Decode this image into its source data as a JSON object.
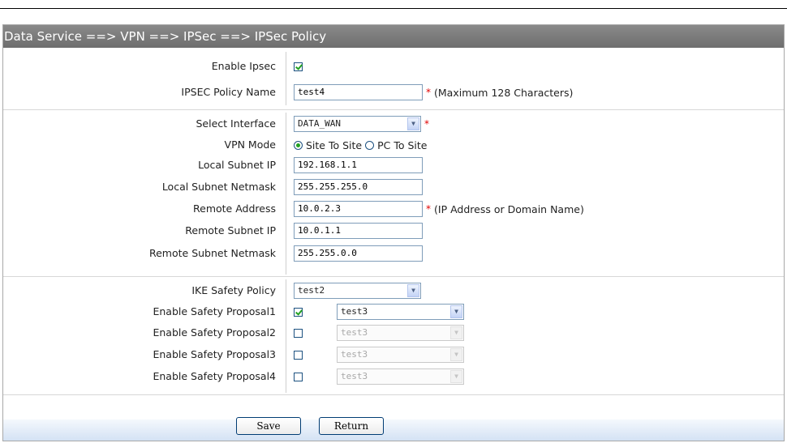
{
  "breadcrumb": "Data Service ==> VPN ==> IPSec ==> IPSec Policy",
  "policy": {
    "enable_ipsec": {
      "label": "Enable Ipsec",
      "checked": true
    },
    "name": {
      "label": "IPSEC Policy Name",
      "value": "test4",
      "required": "*",
      "note": "(Maximum 128 Characters)"
    }
  },
  "network": {
    "interface": {
      "label": "Select Interface",
      "value": "DATA_WAN",
      "required": "*"
    },
    "vpn_mode": {
      "label": "VPN Mode",
      "options": [
        "Site To Site",
        "PC To Site"
      ],
      "selected": "Site To Site"
    },
    "local_ip": {
      "label": "Local Subnet IP",
      "value": "192.168.1.1"
    },
    "local_mask": {
      "label": "Local Subnet Netmask",
      "value": "255.255.255.0"
    },
    "remote_addr": {
      "label": "Remote Address",
      "value": "10.0.2.3",
      "required": "*",
      "note": "(IP Address or Domain Name)"
    },
    "remote_ip": {
      "label": "Remote Subnet IP",
      "value": "10.0.1.1"
    },
    "remote_mask": {
      "label": "Remote Subnet Netmask",
      "value": "255.255.0.0"
    }
  },
  "security": {
    "ike_policy": {
      "label": "IKE Safety Policy",
      "value": "test2"
    },
    "proposals": [
      {
        "label": "Enable Safety Proposal1",
        "checked": true,
        "value": "test3"
      },
      {
        "label": "Enable Safety Proposal2",
        "checked": false,
        "value": "test3"
      },
      {
        "label": "Enable Safety Proposal3",
        "checked": false,
        "value": "test3"
      },
      {
        "label": "Enable Safety Proposal4",
        "checked": false,
        "value": "test3"
      }
    ]
  },
  "buttons": {
    "save": "Save",
    "return": "Return"
  },
  "colors": {
    "header": "#7a7a7a",
    "required": "#e00000",
    "check": "#21a121",
    "footer": "#d4e2f4"
  }
}
